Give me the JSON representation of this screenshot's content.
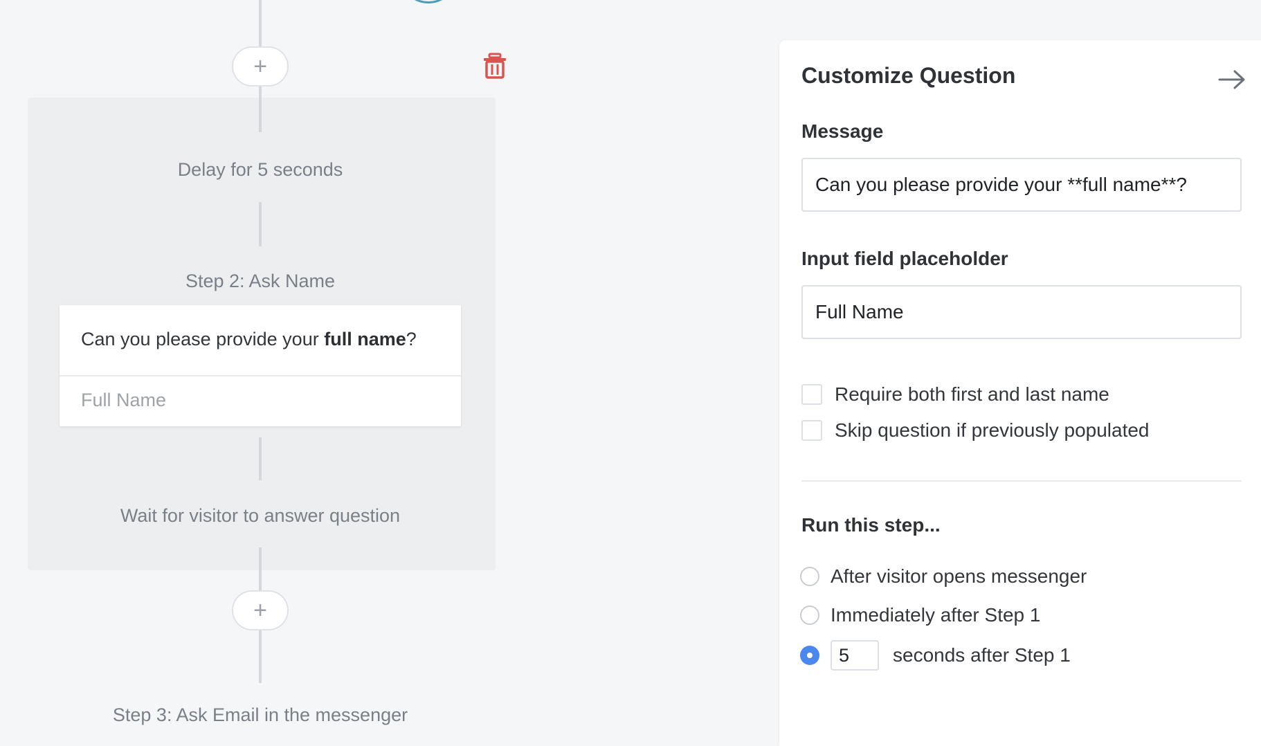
{
  "flow": {
    "add_button_symbol": "+",
    "delay_label": "Delay for 5 seconds",
    "step2_title": "Step 2: Ask Name",
    "preview": {
      "message_prefix": "Can you please provide your ",
      "message_bold": "full name",
      "message_suffix": "?",
      "input_placeholder": "Full Name"
    },
    "wait_label": "Wait for visitor to answer question",
    "step3_title": "Step 3: Ask Email in the messenger",
    "icons": {
      "trash": "trash-icon",
      "add": "plus-icon"
    },
    "colors": {
      "trash": "#d9534f"
    }
  },
  "panel": {
    "title": "Customize Question",
    "close_icon": "arrow-right-icon",
    "message_label": "Message",
    "message_value": "Can you please provide your **full name**?",
    "placeholder_label": "Input field placeholder",
    "placeholder_value": "Full Name",
    "checkboxes": [
      {
        "label": "Require both first and last name",
        "checked": false
      },
      {
        "label": "Skip question if previously populated",
        "checked": false
      }
    ],
    "run_section_title": "Run this step...",
    "run_options": [
      {
        "label": "After visitor opens messenger",
        "checked": false
      },
      {
        "label": "Immediately after Step 1",
        "checked": false
      },
      {
        "label": "seconds after Step 1",
        "checked": true,
        "seconds": "5"
      }
    ],
    "colors": {
      "radio_selected": "#4a87ee"
    }
  }
}
